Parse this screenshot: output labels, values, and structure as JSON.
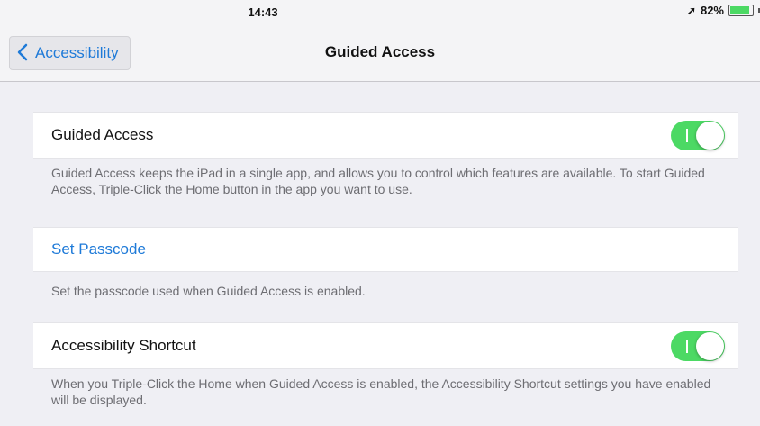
{
  "status": {
    "time": "14:43",
    "battery": "82%",
    "battery_level": 0.82
  },
  "nav": {
    "back_label": "Accessibility",
    "title": "Guided Access"
  },
  "guided_access": {
    "label": "Guided Access",
    "enabled": true,
    "footer": "Guided Access keeps the iPad in a single app, and allows you to control which features are available. To start Guided Access, Triple-Click the Home button in the app you want to use."
  },
  "passcode": {
    "label": "Set Passcode",
    "footer": "Set the passcode used when Guided Access is enabled."
  },
  "shortcut": {
    "label": "Accessibility Shortcut",
    "enabled": true,
    "footer": "When you Triple-Click the Home when Guided Access is enabled, the Accessibility Shortcut settings you have enabled will be displayed."
  },
  "colors": {
    "accent": "#1e7ad8",
    "toggle_on": "#4cd964"
  }
}
